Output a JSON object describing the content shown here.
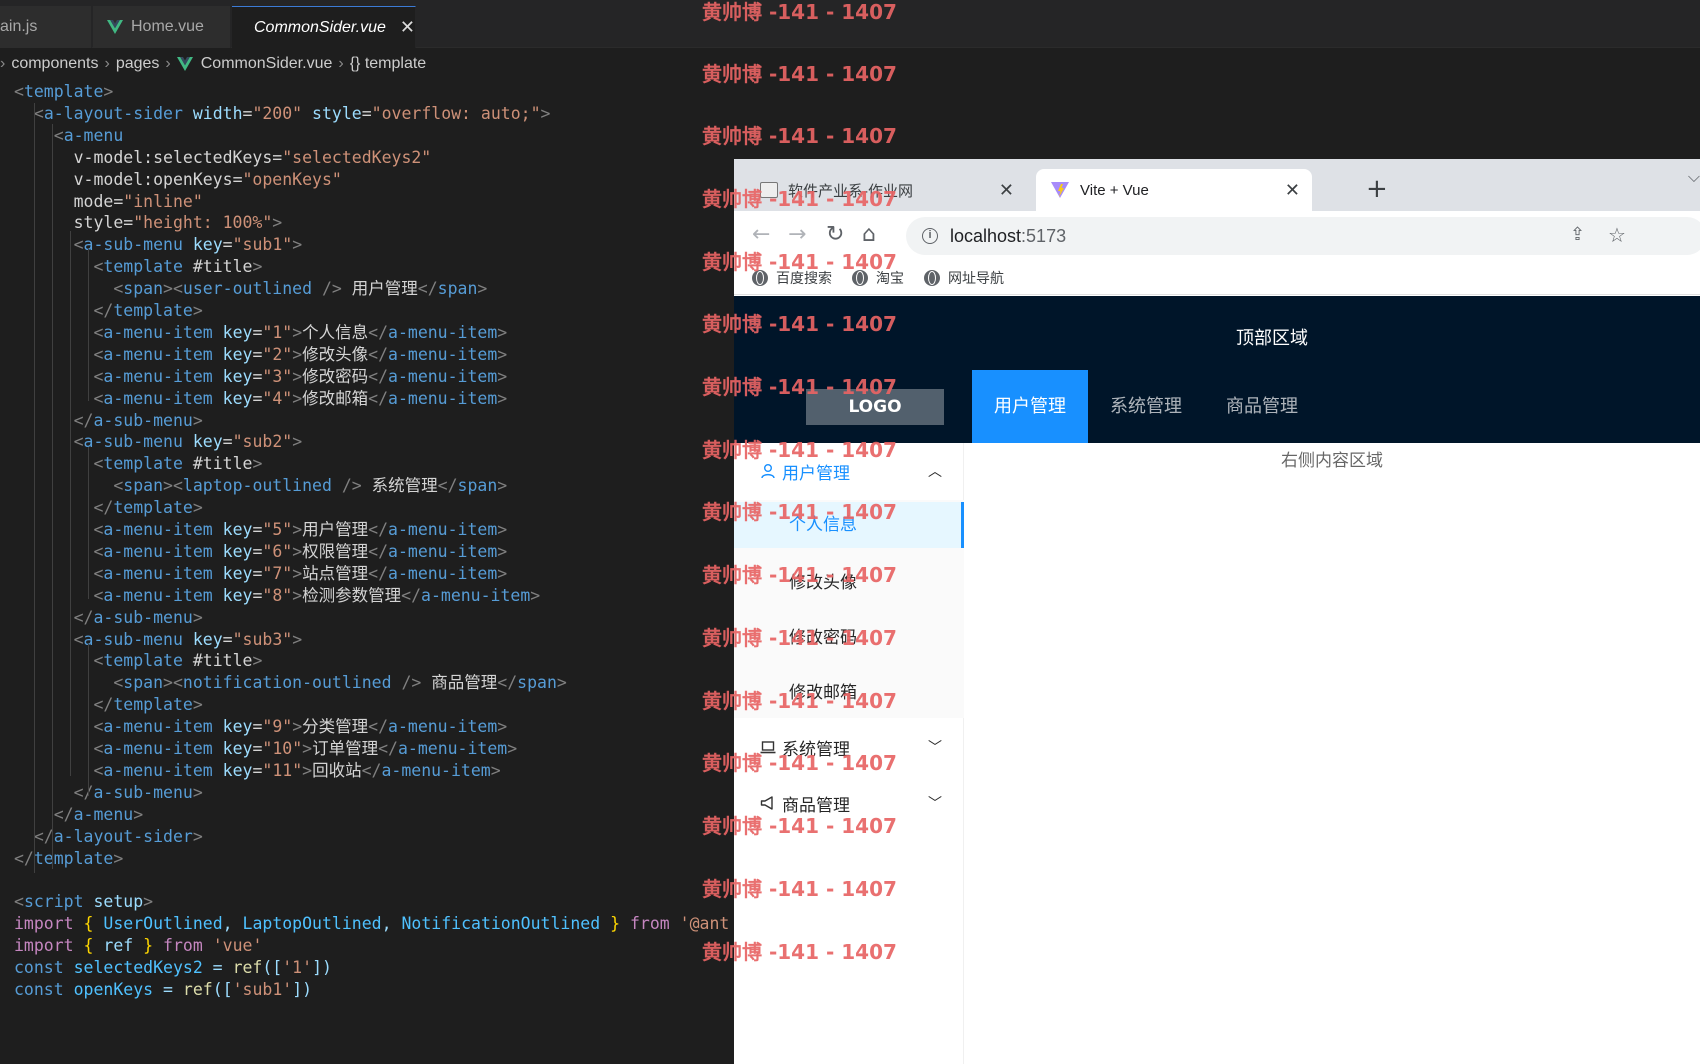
{
  "editor": {
    "tabs": [
      {
        "label": "ain.js"
      },
      {
        "label": "Home.vue"
      },
      {
        "label": "CommonSider.vue"
      }
    ],
    "tab_close": "✕",
    "breadcrumb": [
      "components",
      "pages",
      "CommonSider.vue",
      "{} template"
    ],
    "code_lines": [
      "<template>",
      "  <a-layout-sider width=\"200\" style=\"overflow: auto;\">",
      "    <a-menu",
      "      v-model:selectedKeys=\"selectedKeys2\"",
      "      v-model:openKeys=\"openKeys\"",
      "      mode=\"inline\"",
      "      style=\"height: 100%\">",
      "      <a-sub-menu key=\"sub1\">",
      "        <template #title>",
      "          <span><user-outlined /> 用户管理</span>",
      "        </template>",
      "        <a-menu-item key=\"1\">个人信息</a-menu-item>",
      "        <a-menu-item key=\"2\">修改头像</a-menu-item>",
      "        <a-menu-item key=\"3\">修改密码</a-menu-item>",
      "        <a-menu-item key=\"4\">修改邮箱</a-menu-item>",
      "      </a-sub-menu>",
      "      <a-sub-menu key=\"sub2\">",
      "        <template #title>",
      "          <span><laptop-outlined /> 系统管理</span>",
      "        </template>",
      "        <a-menu-item key=\"5\">用户管理</a-menu-item>",
      "        <a-menu-item key=\"6\">权限管理</a-menu-item>",
      "        <a-menu-item key=\"7\">站点管理</a-menu-item>",
      "        <a-menu-item key=\"8\">检测参数管理</a-menu-item>",
      "      </a-sub-menu>",
      "      <a-sub-menu key=\"sub3\">",
      "        <template #title>",
      "          <span><notification-outlined /> 商品管理</span>",
      "        </template>",
      "        <a-menu-item key=\"9\">分类管理</a-menu-item>",
      "        <a-menu-item key=\"10\">订单管理</a-menu-item>",
      "        <a-menu-item key=\"11\">回收站</a-menu-item>",
      "      </a-sub-menu>",
      "    </a-menu>",
      "  </a-layout-sider>",
      "</template>",
      "",
      "<script setup>",
      "import { UserOutlined, LaptopOutlined, NotificationOutlined } from '@ant",
      "import { ref } from 'vue'",
      "const selectedKeys2 = ref(['1'])",
      "const openKeys = ref(['sub1'])"
    ]
  },
  "browser": {
    "tabs": [
      {
        "label": "软件产业系-作业网",
        "close": "✕"
      },
      {
        "label": "Vite + Vue",
        "close": "✕"
      }
    ],
    "new_tab": "+",
    "address": {
      "host": "localhost",
      "port": ":5173"
    },
    "bookmarks": [
      "百度搜索",
      "淘宝",
      "网址导航"
    ]
  },
  "page": {
    "header_title": "顶部区域",
    "logo": "LOGO",
    "top_menu": [
      "用户管理",
      "系统管理",
      "商品管理"
    ],
    "sider": {
      "sub1_title": "用户管理",
      "sub1_items": [
        "个人信息",
        "修改头像",
        "修改密码",
        "修改邮箱"
      ],
      "sub2_title": "系统管理",
      "sub3_title": "商品管理"
    },
    "content_text": "右侧内容区域"
  },
  "watermark": "黄帅博 -141 - 1407",
  "colors": {
    "antd_primary": "#1890ff",
    "header_bg": "#001529",
    "watermark": "#e86464",
    "editor_bg": "#1e1e1e"
  }
}
